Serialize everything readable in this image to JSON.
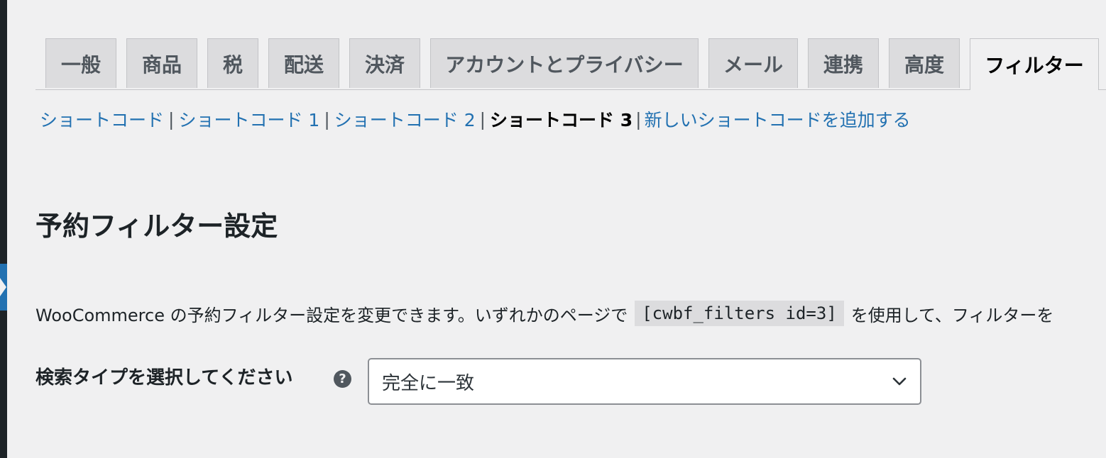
{
  "tabs": [
    {
      "label": "一般"
    },
    {
      "label": "商品"
    },
    {
      "label": "税"
    },
    {
      "label": "配送"
    },
    {
      "label": "決済"
    },
    {
      "label": "アカウントとプライバシー"
    },
    {
      "label": "メール"
    },
    {
      "label": "連携"
    },
    {
      "label": "高度"
    },
    {
      "label": "フィルター",
      "active": true
    }
  ],
  "subnav": {
    "items": [
      {
        "label": "ショートコード"
      },
      {
        "label": "ショートコード 1"
      },
      {
        "label": "ショートコード 2"
      },
      {
        "label": "ショートコード 3",
        "current": true
      },
      {
        "label": "新しいショートコードを追加する"
      }
    ],
    "separator": "|"
  },
  "page_title": "予約フィルター設定",
  "description": {
    "before": "WooCommerce の予約フィルター設定を変更できます。いずれかのページで",
    "code": "[cwbf_filters id=3]",
    "after": "を使用して、フィルターを"
  },
  "search_type": {
    "label": "検索タイプを選択してください",
    "help_glyph": "?",
    "selected": "完全に一致"
  },
  "icons": {
    "help": "help-circle-icon",
    "dropdown": "chevron-down-icon"
  },
  "colors": {
    "link": "#2271b1",
    "background": "#f0f0f1",
    "admin_bar": "#1d2327"
  }
}
